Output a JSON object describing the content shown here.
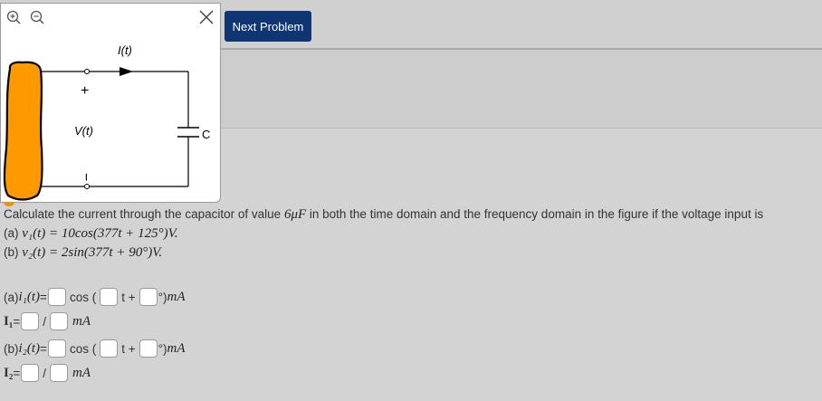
{
  "toolbar": {
    "next_label": "Next Problem",
    "zoom_in_icon": "zoom-in-icon",
    "zoom_out_icon": "zoom-out-icon",
    "close_icon": "close-icon"
  },
  "figure": {
    "current_label": "I(t)",
    "plus_label": "+",
    "voltage_label": "V(t)",
    "minus_label": "−",
    "capacitor_label": "C",
    "source_color": "#ff9900"
  },
  "question": {
    "text_before": "Calculate the current through the capacitor of value ",
    "cap_value": "6μF",
    "text_after": " in both the time domain and the frequency domain in the figure if the voltage input is",
    "part_a_prefix": "(a) ",
    "part_a_math": "v₁(t) = 10cos(377t + 125°)V.",
    "part_b_prefix": "(b) ",
    "part_b_math": "v₂(t) = 2sin(377t + 90°)V."
  },
  "answers": {
    "a_prefix": "(a) ",
    "a_var": "i₁(t)",
    "eq": " =",
    "cos_label": "cos (",
    "t_plus": "t +",
    "deg_unit": "°) ",
    "unit": "mA",
    "phasor_1": "I₁",
    "phasor_2": "I₂",
    "slash": "/",
    "b_prefix": "(b) ",
    "b_var": "i₂(t)"
  }
}
